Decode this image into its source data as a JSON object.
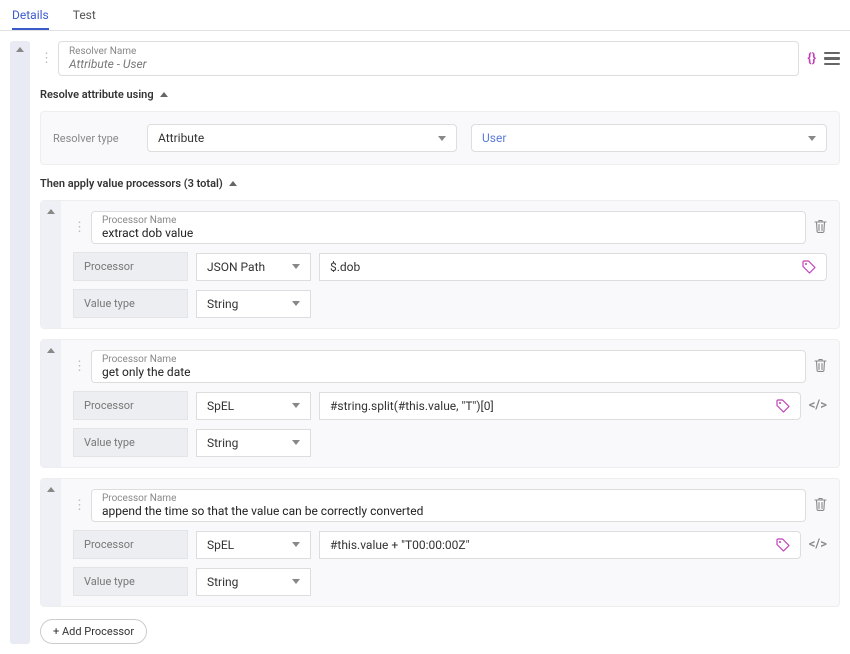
{
  "tabs": {
    "details": "Details",
    "test": "Test"
  },
  "resolver": {
    "name_label": "Resolver Name",
    "name_value": "Attribute - User"
  },
  "resolve_section": {
    "header": "Resolve attribute using",
    "type_label": "Resolver type",
    "type_value": "Attribute",
    "scope_value": "User"
  },
  "processors_section": {
    "header": "Then apply value processors (3 total)"
  },
  "processors": [
    {
      "name_label": "Processor Name",
      "name_value": "extract dob value",
      "processor_label": "Processor",
      "processor_value": "JSON Path",
      "expr_value": "$.dob",
      "valuetype_label": "Value type",
      "valuetype_value": "String",
      "show_code_icon": false
    },
    {
      "name_label": "Processor Name",
      "name_value": "get only the date",
      "processor_label": "Processor",
      "processor_value": "SpEL",
      "expr_value": "#string.split(#this.value, \"T\")[0]",
      "valuetype_label": "Value type",
      "valuetype_value": "String",
      "show_code_icon": true
    },
    {
      "name_label": "Processor Name",
      "name_value": "append the time so that the value can be correctly converted",
      "processor_label": "Processor",
      "processor_value": "SpEL",
      "expr_value": "#this.value + \"T00:00:00Z\"",
      "valuetype_label": "Value type",
      "valuetype_value": "String",
      "show_code_icon": true
    }
  ],
  "add_processor": "+ Add Processor"
}
